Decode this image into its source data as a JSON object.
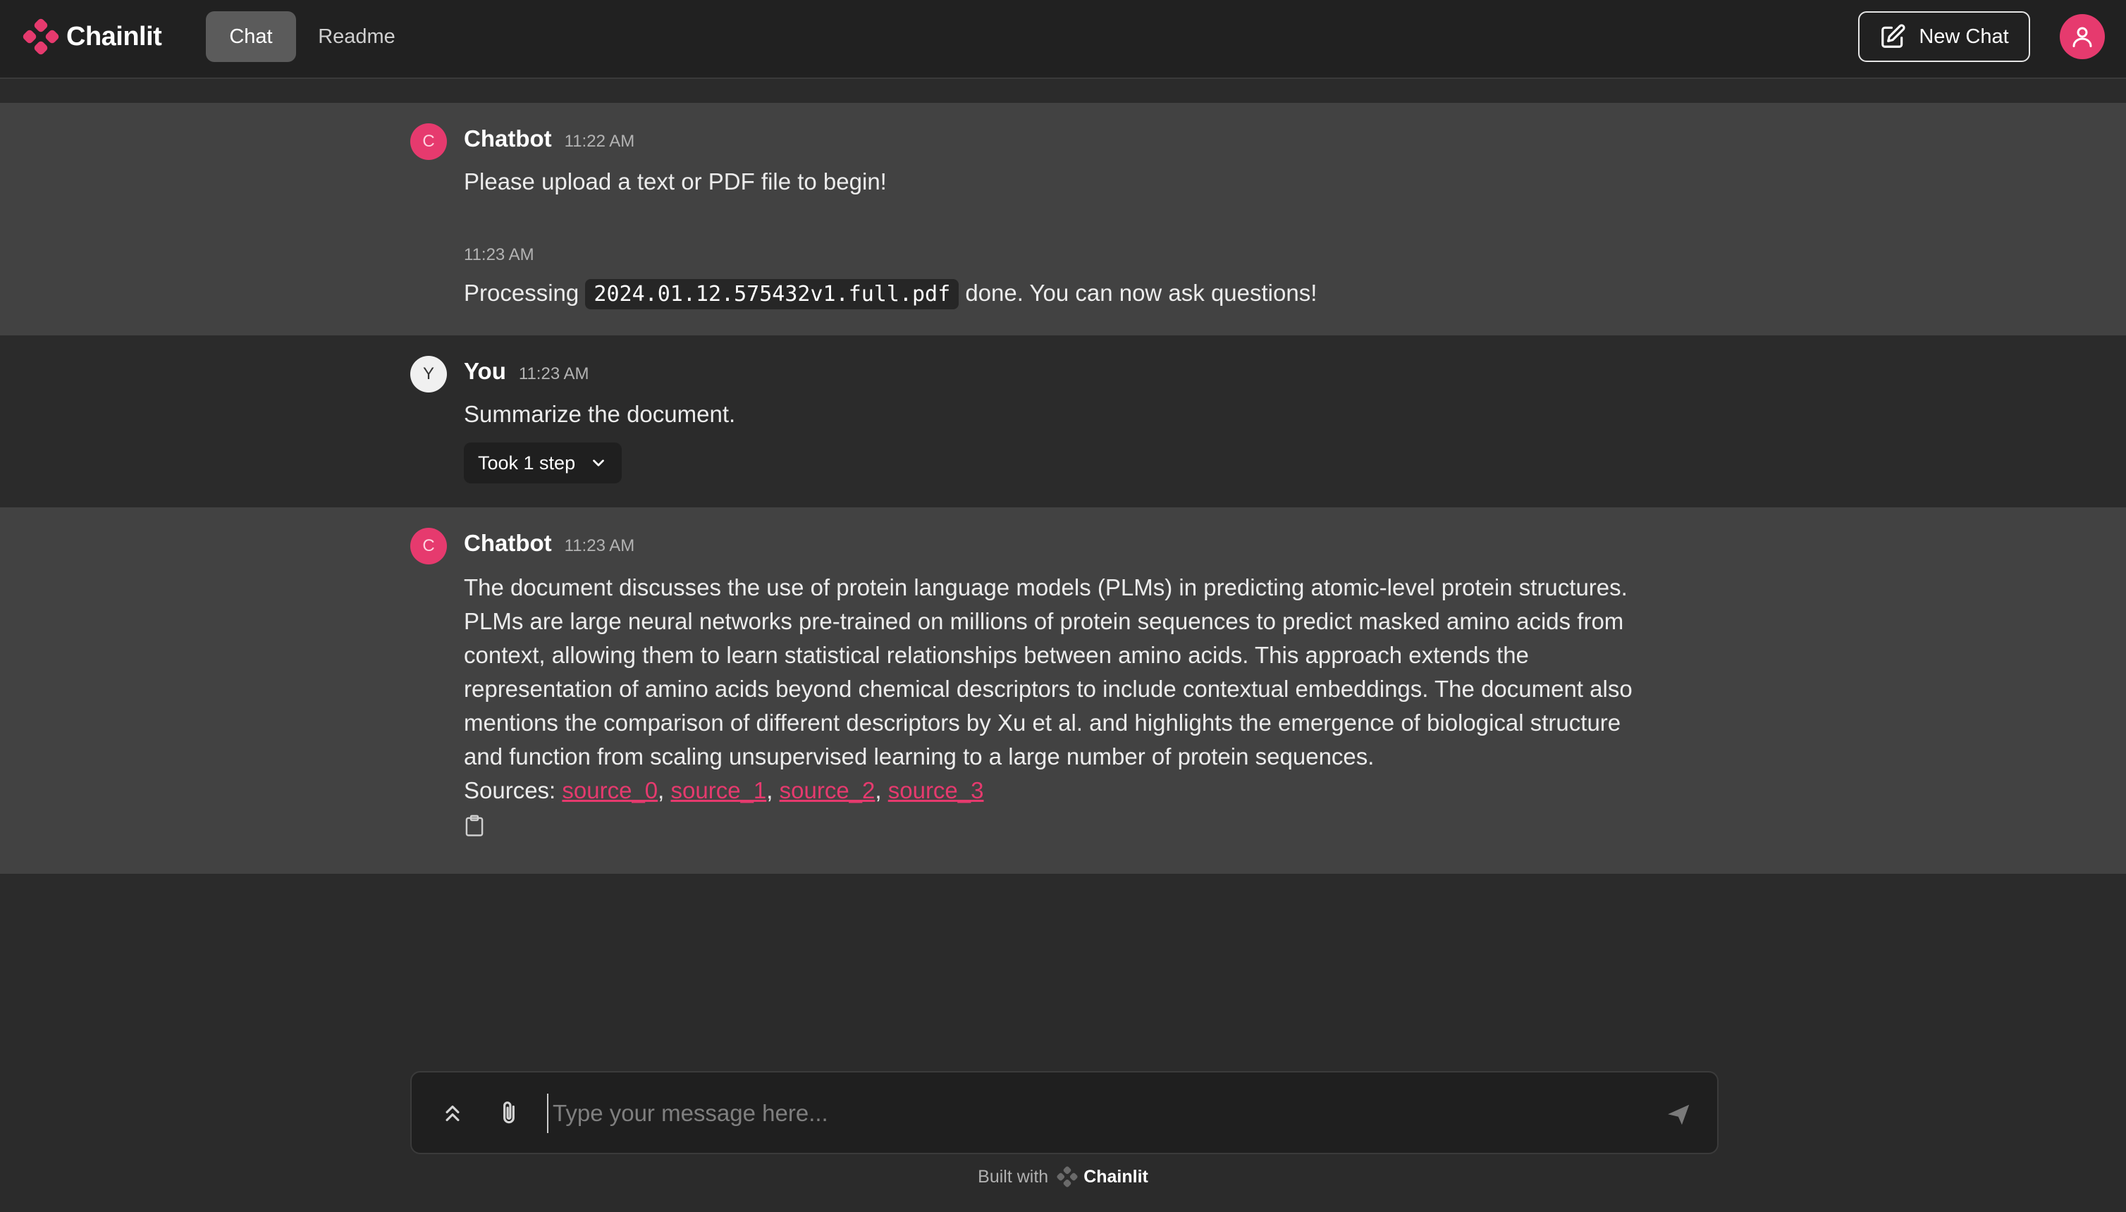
{
  "app": {
    "name": "Chainlit",
    "accent_color": "#e63a6e"
  },
  "header": {
    "tabs": [
      {
        "label": "Chat",
        "active": true
      },
      {
        "label": "Readme",
        "active": false
      }
    ],
    "new_chat_label": "New Chat",
    "new_chat_icon": "edit-square-icon",
    "user_icon": "user-icon"
  },
  "messages": [
    {
      "author": "Chatbot",
      "avatar_letter": "C",
      "time": "11:22 AM",
      "text": "Please upload a text or PDF file to begin!"
    },
    {
      "time": "11:23 AM",
      "text_before": "Processing",
      "file_name": "2024.01.12.575432v1.full.pdf",
      "text_after": "done. You can now ask questions!"
    },
    {
      "author": "You",
      "avatar_letter": "Y",
      "time": "11:23 AM",
      "text": "Summarize the document.",
      "step_label": "Took 1 step"
    },
    {
      "author": "Chatbot",
      "avatar_letter": "C",
      "time": "11:23 AM",
      "lines": [
        "The document discusses the use of protein language models (PLMs) in predicting atomic-level protein structures.",
        "PLMs are large neural networks pre-trained on millions of protein sequences to predict masked amino acids from",
        "context, allowing them to learn statistical relationships between amino acids. This approach extends the",
        "representation of amino acids beyond chemical descriptors to include contextual embeddings. The document also",
        "mentions the comparison of different descriptors by Xu et al. and highlights the emergence of biological structure",
        "and function from scaling unsupervised learning to a large number of protein sequences."
      ],
      "sources_label": "Sources:",
      "sources": [
        "source_0",
        "source_1",
        "source_2",
        "source_3"
      ],
      "copy_icon": "clipboard-icon"
    }
  ],
  "composer": {
    "placeholder": "Type your message here...",
    "value": "",
    "expand_icon": "chevrons-up-icon",
    "attach_icon": "paperclip-icon",
    "send_icon": "send-icon"
  },
  "footer": {
    "built_with": "Built with",
    "brand": "Chainlit"
  }
}
